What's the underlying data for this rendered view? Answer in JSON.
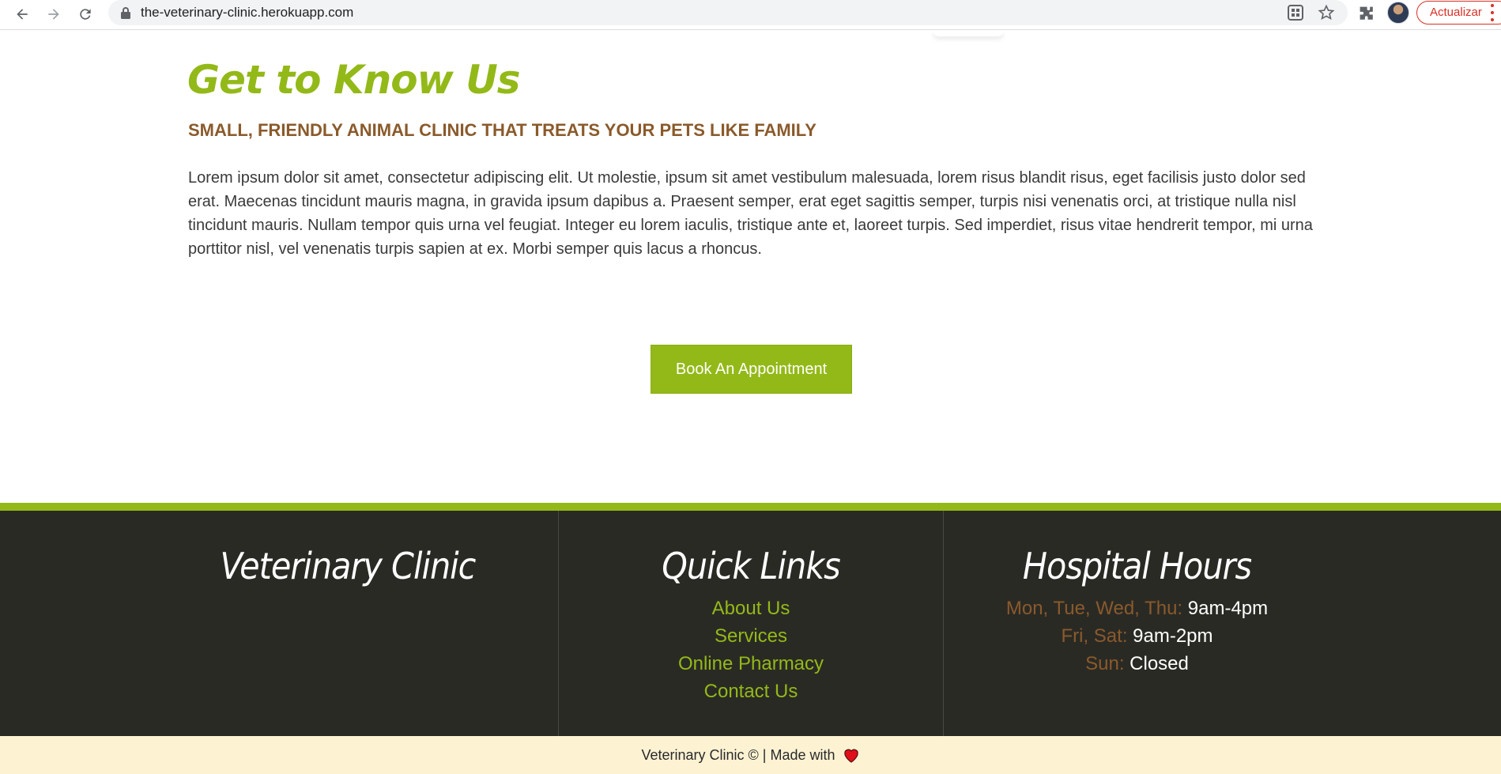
{
  "browser": {
    "url": "the-veterinary-clinic.herokuapp.com",
    "update_label": "Actualizar",
    "icons": [
      "back-icon",
      "forward-icon",
      "reload-icon",
      "lock-icon",
      "qr-code-icon",
      "star-icon",
      "extensions-icon",
      "profile-avatar",
      "more-menu-icon"
    ]
  },
  "about": {
    "heading": "Get to Know Us",
    "subheading": "SMALL, FRIENDLY ANIMAL CLINIC THAT TREATS YOUR PETS LIKE FAMILY",
    "body": "Lorem ipsum dolor sit amet, consectetur adipiscing elit. Ut molestie, ipsum sit amet vestibulum malesuada, lorem risus blandit risus, eget facilisis justo dolor sed erat. Maecenas tincidunt mauris magna, in gravida ipsum dapibus a. Praesent semper, erat eget sagittis semper, turpis nisi venenatis orci, at tristique nulla nisl tincidunt mauris. Nullam tempor quis urna vel feugiat. Integer eu lorem iaculis, tristique ante et, laoreet turpis. Sed imperdiet, risus vitae hendrerit tempor, mi urna porttitor nisl, vel venenatis turpis sapien at ex. Morbi semper quis lacus a rhoncus.",
    "cta_label": "Book An Appointment"
  },
  "footer": {
    "brand": "Veterinary Clinic",
    "quick_links": {
      "heading": "Quick Links",
      "items": [
        "About Us",
        "Services",
        "Online Pharmacy",
        "Contact Us"
      ]
    },
    "hours": {
      "heading": "Hospital Hours",
      "rows": [
        {
          "day": "Mon, Tue, Wed, Thu:",
          "time": "9am-4pm"
        },
        {
          "day": "Fri, Sat:",
          "time": "9am-2pm"
        },
        {
          "day": "Sun:",
          "time": "Closed"
        }
      ]
    },
    "copyright": "Veterinary Clinic © | Made with"
  },
  "colors": {
    "accent_green": "#93b918",
    "brown": "#8a5a2b",
    "footer_bg": "#2a2a25",
    "copyright_bg": "#fdf3d3",
    "heart": "#e0101a"
  }
}
